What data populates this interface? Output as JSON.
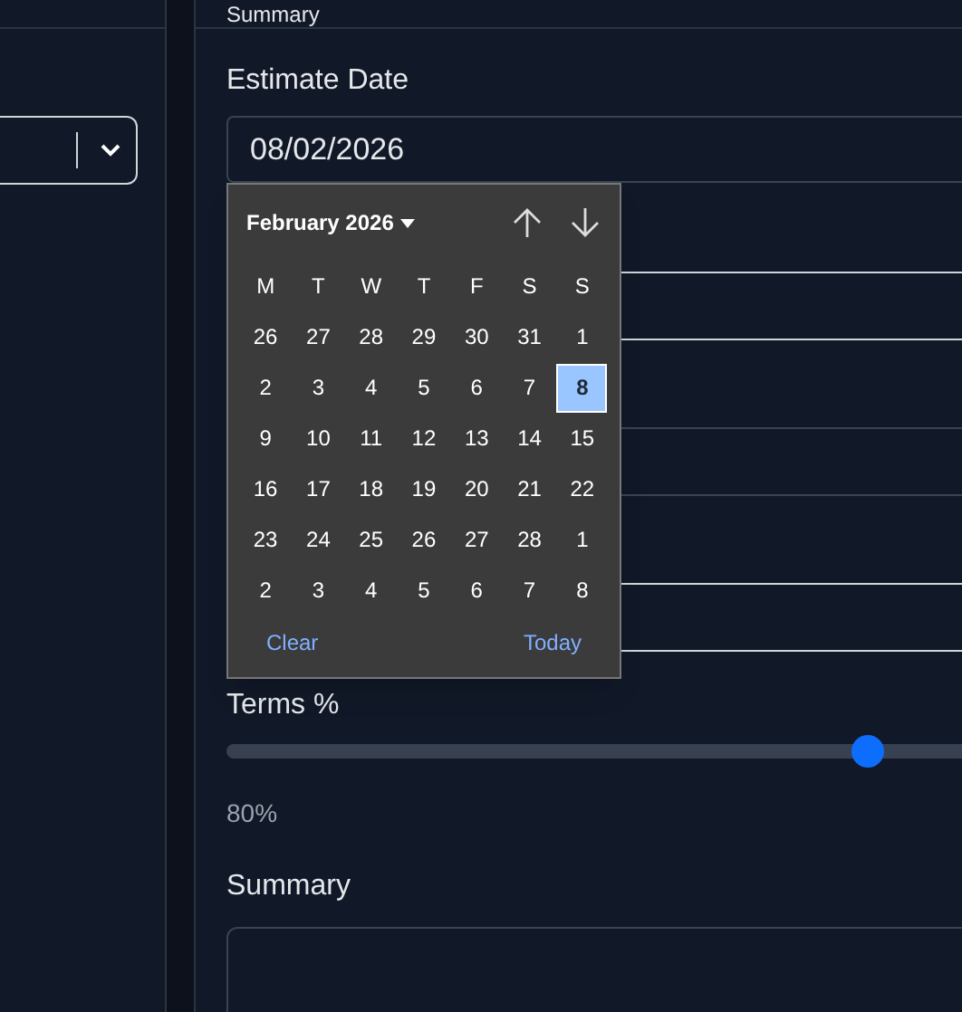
{
  "header": {
    "title": "Summary"
  },
  "estimate_date": {
    "label": "Estimate Date",
    "value": "08/02/2026"
  },
  "calendar": {
    "month": "February 2026",
    "weekdays": [
      "M",
      "T",
      "W",
      "T",
      "F",
      "S",
      "S"
    ],
    "weeks": [
      [
        {
          "day": "26",
          "selected": false
        },
        {
          "day": "27",
          "selected": false
        },
        {
          "day": "28",
          "selected": false
        },
        {
          "day": "29",
          "selected": false
        },
        {
          "day": "30",
          "selected": false
        },
        {
          "day": "31",
          "selected": false
        },
        {
          "day": "1",
          "selected": false
        }
      ],
      [
        {
          "day": "2",
          "selected": false
        },
        {
          "day": "3",
          "selected": false
        },
        {
          "day": "4",
          "selected": false
        },
        {
          "day": "5",
          "selected": false
        },
        {
          "day": "6",
          "selected": false
        },
        {
          "day": "7",
          "selected": false
        },
        {
          "day": "8",
          "selected": true
        }
      ],
      [
        {
          "day": "9",
          "selected": false
        },
        {
          "day": "10",
          "selected": false
        },
        {
          "day": "11",
          "selected": false
        },
        {
          "day": "12",
          "selected": false
        },
        {
          "day": "13",
          "selected": false
        },
        {
          "day": "14",
          "selected": false
        },
        {
          "day": "15",
          "selected": false
        }
      ],
      [
        {
          "day": "16",
          "selected": false
        },
        {
          "day": "17",
          "selected": false
        },
        {
          "day": "18",
          "selected": false
        },
        {
          "day": "19",
          "selected": false
        },
        {
          "day": "20",
          "selected": false
        },
        {
          "day": "21",
          "selected": false
        },
        {
          "day": "22",
          "selected": false
        }
      ],
      [
        {
          "day": "23",
          "selected": false
        },
        {
          "day": "24",
          "selected": false
        },
        {
          "day": "25",
          "selected": false
        },
        {
          "day": "26",
          "selected": false
        },
        {
          "day": "27",
          "selected": false
        },
        {
          "day": "28",
          "selected": false
        },
        {
          "day": "1",
          "selected": false
        }
      ],
      [
        {
          "day": "2",
          "selected": false
        },
        {
          "day": "3",
          "selected": false
        },
        {
          "day": "4",
          "selected": false
        },
        {
          "day": "5",
          "selected": false
        },
        {
          "day": "6",
          "selected": false
        },
        {
          "day": "7",
          "selected": false
        },
        {
          "day": "8",
          "selected": false
        }
      ]
    ],
    "clear": "Clear",
    "today": "Today"
  },
  "terms": {
    "label": "Terms %",
    "level": 0.8,
    "reading": "80%"
  },
  "summary": {
    "label": "Summary"
  }
}
